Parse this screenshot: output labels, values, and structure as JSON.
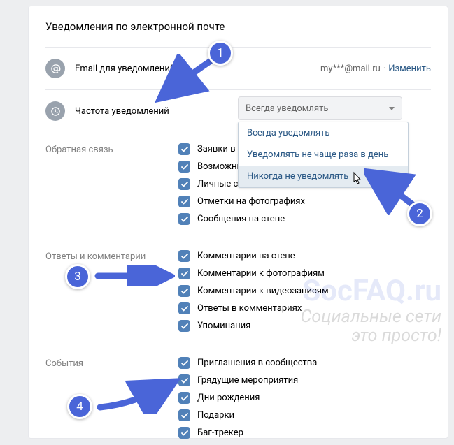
{
  "title": "Уведомления по электронной почте",
  "email_row": {
    "label": "Email для уведомлений",
    "value": "my***@mail.ru",
    "change": "Изменить"
  },
  "freq_row": {
    "label": "Частота уведомлений",
    "selected": "Всегда уведомлять",
    "options": [
      "Всегда уведомлять",
      "Уведомлять не чаще раза в день",
      "Никогда не уведомлять"
    ]
  },
  "sections": {
    "feedback": {
      "label": "Обратная связь",
      "items": [
        "Заявки в дру",
        "Возможные",
        "Личные соо",
        "Отметки на фотографиях",
        "Сообщения на стене"
      ]
    },
    "replies": {
      "label": "Ответы и комментарии",
      "items": [
        "Комментарии на стене",
        "Комментарии к фотографиям",
        "Комментарии к видеозаписям",
        "Ответы в комментариях",
        "Упоминания"
      ]
    },
    "events": {
      "label": "События",
      "items": [
        "Приглашения в сообщества",
        "Грядущие мероприятия",
        "Дни рождения",
        "Подарки",
        "Баг-трекер"
      ]
    }
  },
  "markers": {
    "m1": "1",
    "m2": "2",
    "m3": "3",
    "m4": "4"
  },
  "watermark": {
    "l1": "SocFAQ.ru",
    "l2": "Социальные сети",
    "l3": "это просто!"
  }
}
